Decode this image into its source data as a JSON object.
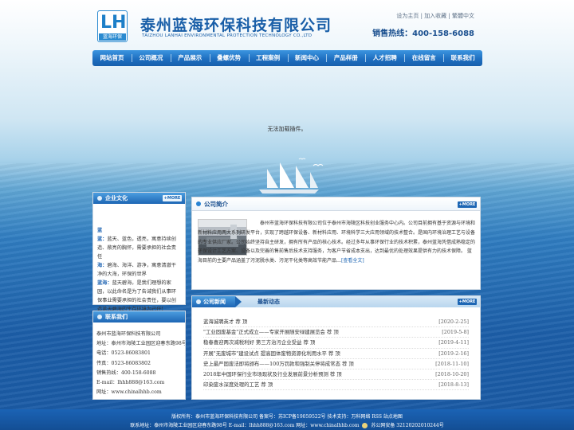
{
  "header": {
    "logo_text": "LH",
    "logo_sub": "蓝海环保",
    "company_name": "泰州蓝海环保科技有限公司",
    "company_en": "TAIZHOU LANHAI ENVIRONMENTAL PROTECTION TECHNOLOGY CO.,LTD",
    "top_links": [
      "设为主页",
      "加入收藏",
      "繁體中文"
    ],
    "hotline": "销售热线：400-158-6088"
  },
  "nav": {
    "items": [
      "网站首页",
      "公司概况",
      "产品展示",
      "叠螺优势",
      "工程案例",
      "新闻中心",
      "产品样册",
      "人才招聘",
      "在线留言",
      "联系我们"
    ]
  },
  "banner": {
    "plugin_message": "无法加载插件。"
  },
  "culture": {
    "title": "企业文化",
    "more": "+MORE",
    "lines": [
      {
        "head": "蓝",
        "text": ""
      },
      {
        "head": "蓝：",
        "text": "蓝天、蓝色，透亮，寓意持续创造、敞亮的胸怀，需要承担的社会责任"
      },
      {
        "head": "海：",
        "text": "碧海、海洋、游净，寓意清澈干净的大海，环保的世界"
      },
      {
        "head": "蓝海：",
        "text": "蓝天碧海，是我们理想的家园，以此命名是为了告诫我们从事环保事业需要承担的社会责任，要以创造蓝天碧海的生存环境为己任!"
      }
    ]
  },
  "contact": {
    "title": "联系我们",
    "lines": [
      "泰州市蓝海环保科技有限公司",
      "地址：泰州市海陵工业园区迎春东路98号",
      "电话：0523-86083801",
      "传真：0523-86083802",
      "销售热线：400-158-6088",
      "E-mail：lhhh888@163.com",
      "网址：www.chinalhhb.com"
    ]
  },
  "intro": {
    "title": "公司简介",
    "more": "+MORE",
    "text": "泰州市蓝海环保科技有限公司位于泰州市海陵区科技创业服务中心内。公司目前拥有基于资源与环境和新材料应用两大系列研发平台，实现了跨越环保设备、新材料应用、环境科学三大应用领域的技术整合。是国内环境治理工艺与设备的专业供应厂家。公司始终坚持自主研发，拥有所有产品的核心技术。经过多年从事环保行业的技术积累，泰州蓝海凭借成熟稳定的环保设计工艺方案、设备以及完善的售前售后技术支持服务，为客户节省成本支出，达到最优的处理效果提供有力的技术保障。 蓝海目前的主要产品涵盖了污泥脱水类、污泥干化类等高效节能产品…",
    "read_more": "[查看全文]"
  },
  "news": {
    "tab_company": "公司新闻",
    "tab_industry": "最新动态",
    "more": "+MORE",
    "items": [
      {
        "title": "蓝海诚聘英才 荐 顶",
        "date": "[2020-2-25]"
      },
      {
        "title": "\"工业固废基金\"正式成立——专家开展随安绿建展览会 荐 顶",
        "date": "[2019-5-8]"
      },
      {
        "title": "稳春喜迎两次减税利好 第三方治污企业受益 荐 顶",
        "date": "[2019-4-11]"
      },
      {
        "title": "开展\"无废城市\"建设试点 提高固体废物资源化利用水平 荐 顶",
        "date": "[2019-2-16]"
      },
      {
        "title": "史上最严固废法即将颁布——100万罚款和强制关停将成常态 荐 顶",
        "date": "[2018-11-10]"
      },
      {
        "title": "2018年中国环保行业市场现状及行业发展前景分析预测 荐 顶",
        "date": "[2018-10-20]"
      },
      {
        "title": "印染废水深度处理的工艺 荐 顶",
        "date": "[2018-8-13]"
      }
    ]
  },
  "footer": {
    "line1": "版权所有：泰州市蓝海环保科技有限公司 备案号：苏ICP备19059522号 技术支持：万科网络 RSS 站点地图",
    "line2a": "联系地址：泰州市海陵工业园区迎春东路98号 E-mail：lhhh888@163.com 网址：www.chinalhhb.com",
    "line2b": "苏公网安备 32120202010244号"
  },
  "colors": {
    "brand_blue": "#1a5fa8",
    "nav_blue": "#1e6fc0",
    "footer_blue": "#134e94"
  }
}
